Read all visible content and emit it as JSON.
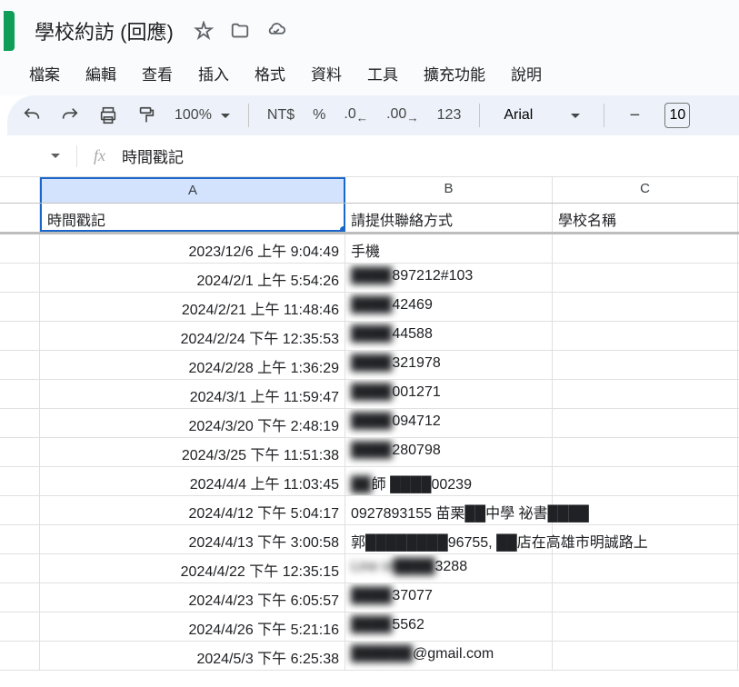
{
  "doc": {
    "title": "學校約訪 (回應)"
  },
  "menu": [
    "檔案",
    "編輯",
    "查看",
    "插入",
    "格式",
    "資料",
    "工具",
    "擴充功能",
    "說明"
  ],
  "toolbar": {
    "zoom": "100%",
    "currency": "NT$",
    "percent": "%",
    "dec_dec": ".0",
    "dec_inc": ".00",
    "numfmt": "123",
    "font": "Arial",
    "fontsize": "10"
  },
  "fx": {
    "text": "時間戳記"
  },
  "columns": {
    "a": "A",
    "b": "B",
    "c": "C"
  },
  "headers": {
    "a": "時間戳記",
    "b": "請提供聯絡方式",
    "c": "學校名稱"
  },
  "rows": [
    {
      "a": "2023/12/6 上午 9:04:49",
      "b": "手機"
    },
    {
      "a": "2024/2/1 上午 5:54:26",
      "b_pre": "████",
      "b": "897212#103"
    },
    {
      "a": "2024/2/21 上午 11:48:46",
      "b_pre": "████",
      "b": "42469"
    },
    {
      "a": "2024/2/24 下午 12:35:53",
      "b_pre": "████",
      "b": "44588"
    },
    {
      "a": "2024/2/28 上午 1:36:29",
      "b_pre": "████",
      "b": "321978"
    },
    {
      "a": "2024/3/1 上午 11:59:47",
      "b_pre": "████",
      "b": "001271"
    },
    {
      "a": "2024/3/20 下午 2:48:19",
      "b_pre": "████",
      "b": "094712"
    },
    {
      "a": "2024/3/25 下午 11:51:38",
      "b_pre": "████",
      "b": "280798"
    },
    {
      "a": "2024/4/4 上午 11:03:45",
      "b_pre": "██",
      "b_mid": "師 ████",
      "b": "00239"
    },
    {
      "a": "2024/4/12 下午 5:04:17",
      "b_full": "0927893155 苗栗██中學 祕書████",
      "overflow": true
    },
    {
      "a": "2024/4/13 下午 3:00:58",
      "b_full": "郭████████96755, ██店在高雄市明誠路上",
      "overflow": true
    },
    {
      "a": "2024/4/22 下午 12:35:15",
      "b_pre": "Line id████",
      "b": "3288"
    },
    {
      "a": "2024/4/23 下午 6:05:57",
      "b_pre": "████",
      "b": "37077"
    },
    {
      "a": "2024/4/26 下午 5:21:16",
      "b_pre": "████",
      "b": "5562"
    },
    {
      "a": "2024/5/3 下午 6:25:38",
      "b_pre": "██████",
      "b": "@gmail.com"
    }
  ]
}
